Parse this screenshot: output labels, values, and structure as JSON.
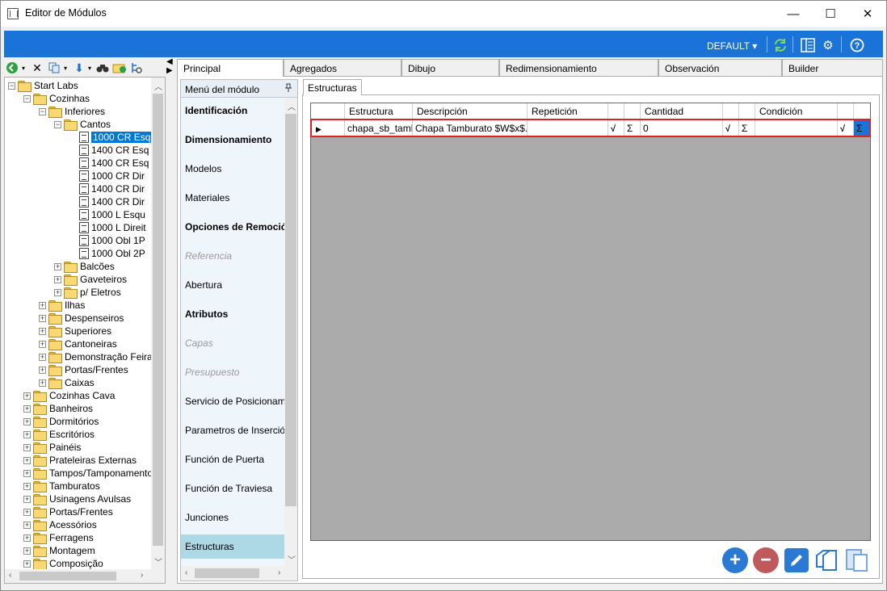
{
  "window": {
    "title": "Editor de Módulos",
    "minimize": "—",
    "maximize": "☐",
    "close": "✕"
  },
  "header": {
    "profile": "DEFAULT ▾",
    "accent_color": "#1a73d9"
  },
  "tree": {
    "items": [
      {
        "label": "Start Labs",
        "type": "folder",
        "expander": "−"
      },
      {
        "label": "Cozinhas",
        "type": "folder",
        "expander": "−"
      },
      {
        "label": "Inferiores",
        "type": "folder",
        "expander": "−"
      },
      {
        "label": "Cantos",
        "type": "folder",
        "expander": "−"
      },
      {
        "label": "1000 CR Esq",
        "type": "doc",
        "selected": true
      },
      {
        "label": "1400 CR Esq",
        "type": "doc"
      },
      {
        "label": "1400 CR Esq",
        "type": "doc"
      },
      {
        "label": "1000 CR Dir",
        "type": "doc"
      },
      {
        "label": "1400 CR Dir",
        "type": "doc"
      },
      {
        "label": "1400 CR Dir",
        "type": "doc"
      },
      {
        "label": "1000 L Esqu",
        "type": "doc"
      },
      {
        "label": "1000 L Direit",
        "type": "doc"
      },
      {
        "label": "1000 Obl 1P",
        "type": "doc"
      },
      {
        "label": "1000 Obl 2P",
        "type": "doc"
      },
      {
        "label": "Balcões",
        "type": "folder",
        "expander": "+"
      },
      {
        "label": "Gaveteiros",
        "type": "folder",
        "expander": "+"
      },
      {
        "label": "p/ Eletros",
        "type": "folder",
        "expander": "+"
      },
      {
        "label": "Ilhas",
        "type": "folder",
        "expander": "+"
      },
      {
        "label": "Despenseiros",
        "type": "folder",
        "expander": "+"
      },
      {
        "label": "Superiores",
        "type": "folder",
        "expander": "+"
      },
      {
        "label": "Cantoneiras",
        "type": "folder",
        "expander": "+"
      },
      {
        "label": "Demonstração Feira",
        "type": "folder",
        "expander": "+"
      },
      {
        "label": "Portas/Frentes",
        "type": "folder",
        "expander": "+"
      },
      {
        "label": "Caixas",
        "type": "folder",
        "expander": "+"
      },
      {
        "label": "Cozinhas Cava",
        "type": "folder",
        "expander": "+"
      },
      {
        "label": "Banheiros",
        "type": "folder",
        "expander": "+"
      },
      {
        "label": "Dormitórios",
        "type": "folder",
        "expander": "+"
      },
      {
        "label": "Escritórios",
        "type": "folder",
        "expander": "+"
      },
      {
        "label": "Painéis",
        "type": "folder",
        "expander": "+"
      },
      {
        "label": "Prateleiras Externas",
        "type": "folder",
        "expander": "+"
      },
      {
        "label": "Tampos/Tamponamento",
        "type": "folder",
        "expander": "+"
      },
      {
        "label": "Tamburatos",
        "type": "folder",
        "expander": "+"
      },
      {
        "label": "Usinagens Avulsas",
        "type": "folder",
        "expander": "+"
      },
      {
        "label": "Portas/Frentes",
        "type": "folder",
        "expander": "+"
      },
      {
        "label": "Acessórios",
        "type": "folder",
        "expander": "+"
      },
      {
        "label": "Ferragens",
        "type": "folder",
        "expander": "+"
      },
      {
        "label": "Montagem",
        "type": "folder",
        "expander": "+"
      },
      {
        "label": "Composição",
        "type": "folder",
        "expander": "+"
      }
    ]
  },
  "tabs": [
    "Principal",
    "Agregados",
    "Dibujo",
    "Redimensionamiento",
    "Observación",
    "Builder"
  ],
  "module_menu": {
    "title": "Menú del módulo",
    "items": [
      {
        "label": "Identificación",
        "style": "bold"
      },
      {
        "label": "Dimensionamiento",
        "style": "bold"
      },
      {
        "label": "Modelos",
        "style": "normal"
      },
      {
        "label": "Materiales",
        "style": "normal"
      },
      {
        "label": "Opciones de Remoción",
        "style": "bold"
      },
      {
        "label": "Referencia",
        "style": "disabled"
      },
      {
        "label": "Abertura",
        "style": "normal"
      },
      {
        "label": "Atributos",
        "style": "bold"
      },
      {
        "label": "Capas",
        "style": "disabled"
      },
      {
        "label": "Presupuesto",
        "style": "disabled"
      },
      {
        "label": "Servicio de Posicionamiento",
        "style": "normal"
      },
      {
        "label": "Parametros de Inserción",
        "style": "normal"
      },
      {
        "label": "Función de Puerta",
        "style": "normal"
      },
      {
        "label": "Función de Traviesa",
        "style": "normal"
      },
      {
        "label": "Junciones",
        "style": "normal"
      },
      {
        "label": "Estructuras",
        "style": "active"
      }
    ]
  },
  "structures": {
    "tab": "Estructuras",
    "columns": [
      "Estructura",
      "Descripción",
      "Repetición",
      "Cantidad",
      "Condición"
    ],
    "row": {
      "estructura": "chapa_sb_tamb",
      "descripcion": "Chapa Tamburato $W$x$...",
      "repeticion": "",
      "cantidad": "0",
      "condicion": ""
    },
    "formula_glyph": "√",
    "sum_glyph": "Σ"
  },
  "actions": {
    "add": "+",
    "remove": "−"
  },
  "highlight_color": "#e0202a"
}
